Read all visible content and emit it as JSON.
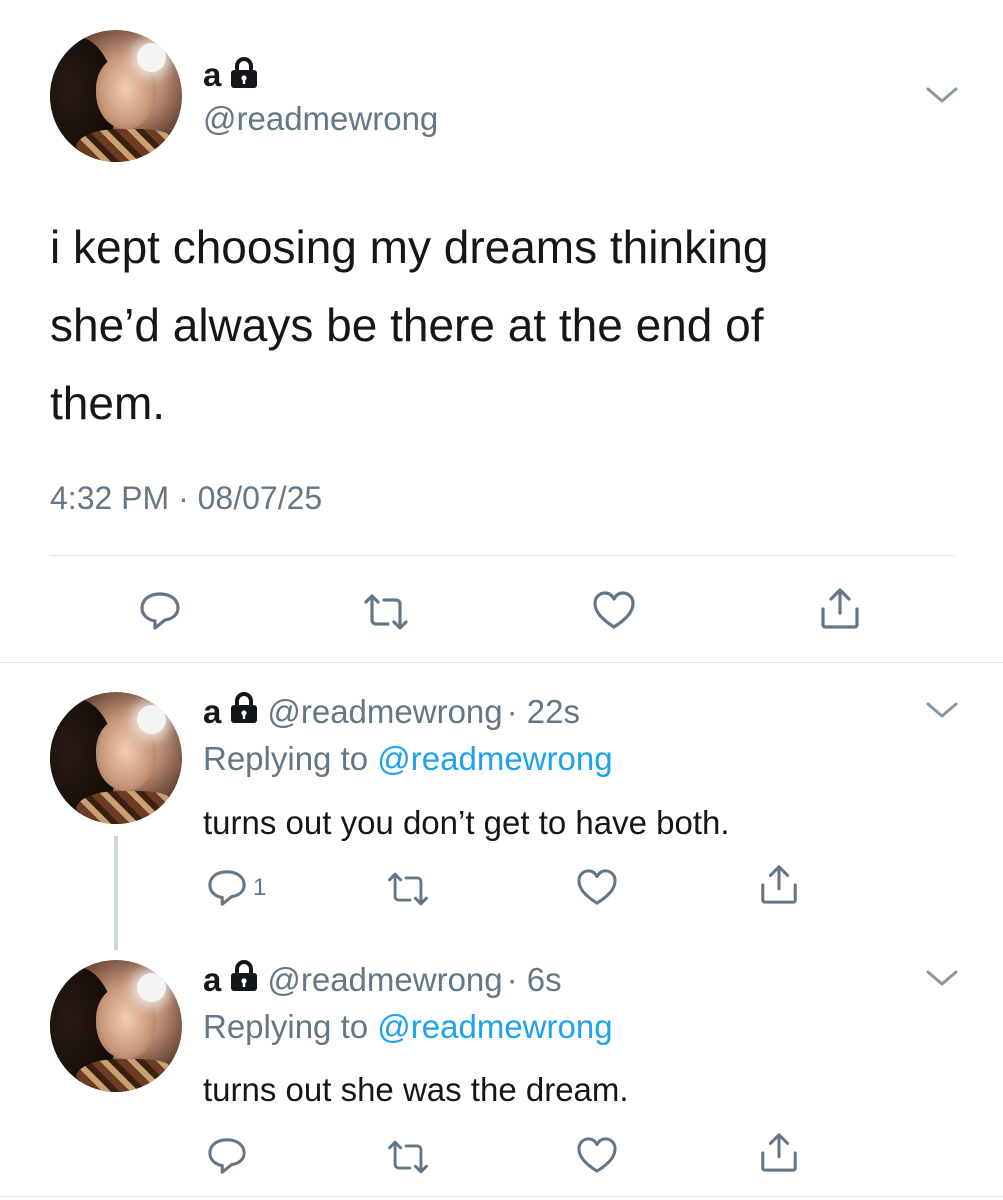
{
  "main_tweet": {
    "name": "a",
    "handle": "@readmewrong",
    "text_line1": "i kept choosing my dreams thinking",
    "text_line2": "she’d always be there at the end of",
    "text_line3": "them.",
    "timestamp": "4:32 PM · 08/07/25"
  },
  "replies": [
    {
      "name": "a",
      "handle": "@readmewrong",
      "time": "· 22s",
      "replying_prefix": "Replying to",
      "replying_handle": "@readmewrong",
      "text": "turns out you don’t get to have both.",
      "reply_count": "1"
    },
    {
      "name": "a",
      "handle": "@readmewrong",
      "time": "· 6s",
      "replying_prefix": "Replying to",
      "replying_handle": "@readmewrong",
      "text": "turns out she was the dream.",
      "reply_count": ""
    }
  ],
  "icons": {
    "lock": "lock-icon",
    "chevron": "chevron-down-icon",
    "reply": "reply-icon",
    "retweet": "retweet-icon",
    "like": "heart-icon",
    "share": "share-icon"
  },
  "colors": {
    "text": "#14171a",
    "secondary": "#657786",
    "link": "#1da1f2",
    "divider": "#e1e8ed"
  }
}
